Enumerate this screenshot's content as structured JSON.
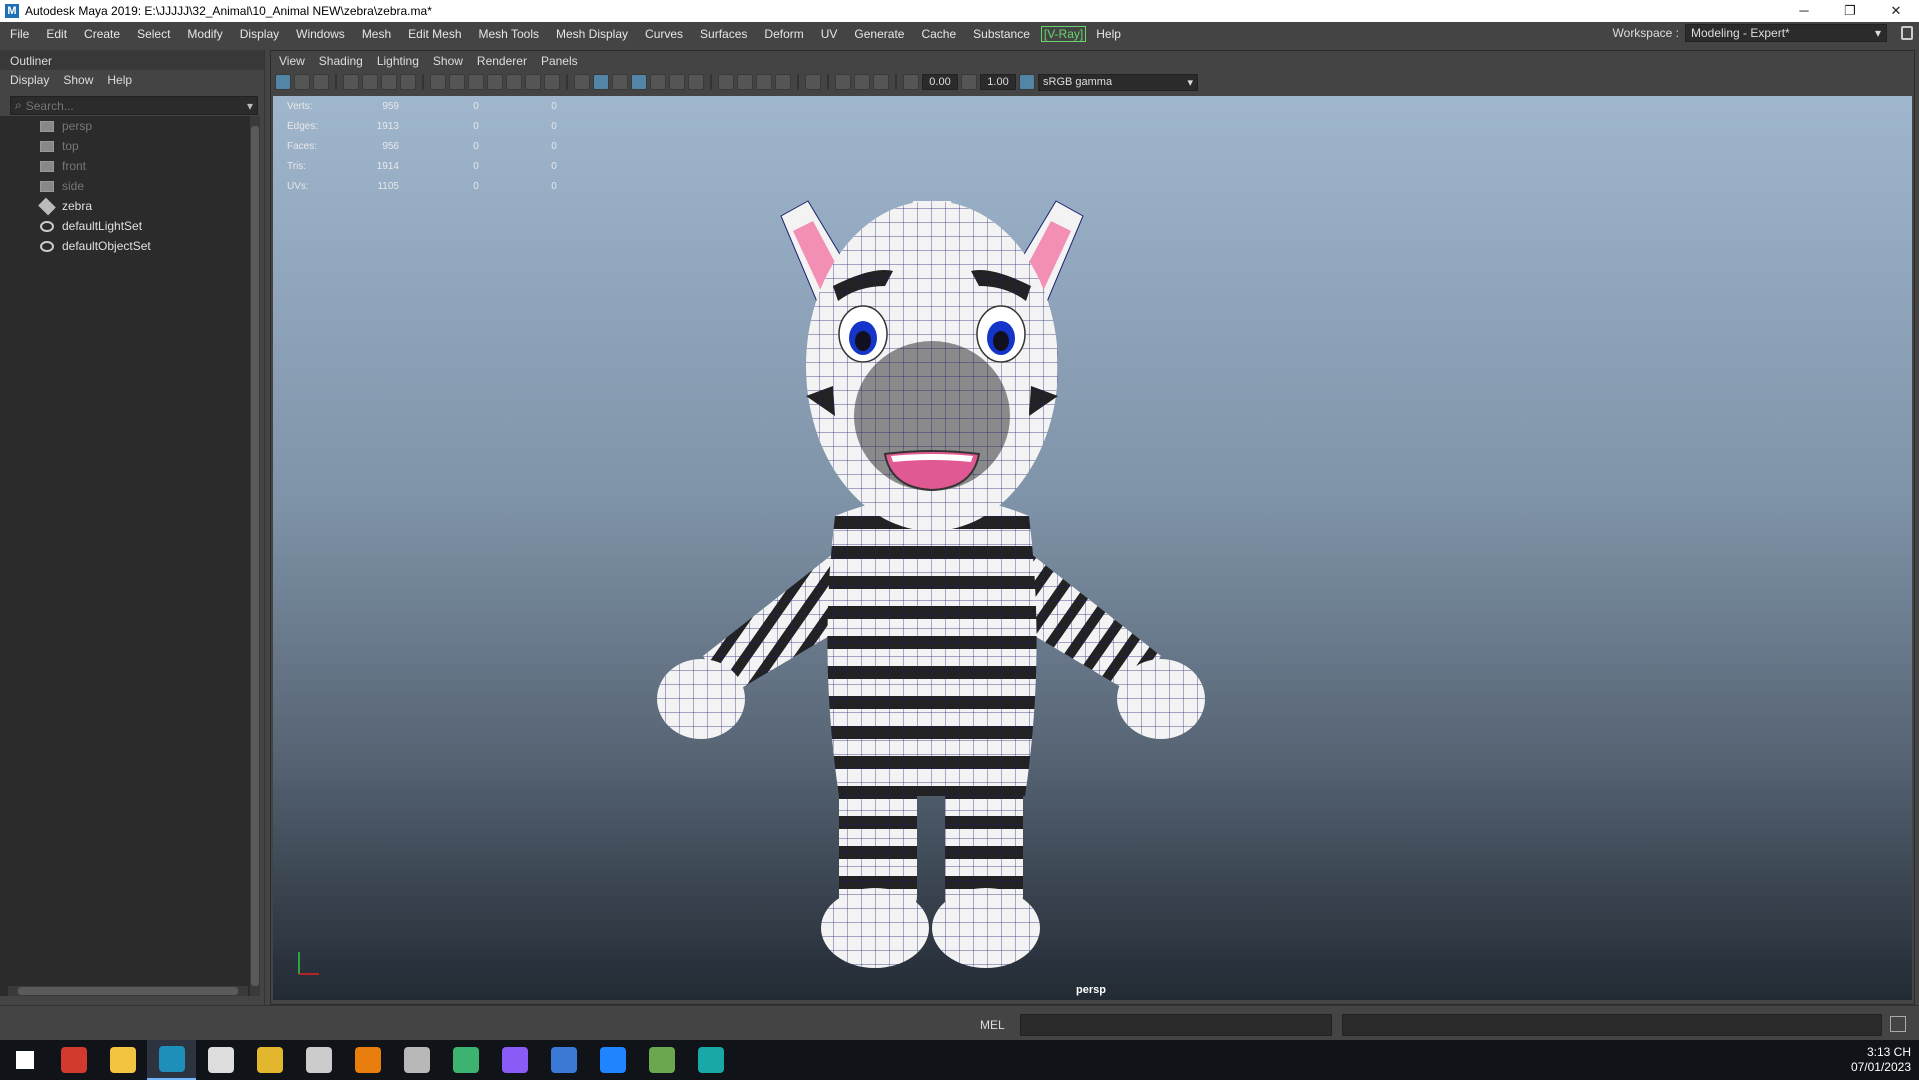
{
  "window": {
    "title": "Autodesk Maya 2019: E:\\JJJJJ\\32_Animal\\10_Animal NEW\\zebra\\zebra.ma*",
    "app_icon": "M",
    "controls": {
      "minimize": "─",
      "restore": "❐",
      "close": "✕"
    }
  },
  "menubar": {
    "items": [
      "File",
      "Edit",
      "Create",
      "Select",
      "Modify",
      "Display",
      "Windows",
      "Mesh",
      "Edit Mesh",
      "Mesh Tools",
      "Mesh Display",
      "Curves",
      "Surfaces",
      "Deform",
      "UV",
      "Generate",
      "Cache",
      "Substance"
    ],
    "vray": "[V-Ray]",
    "help": "Help",
    "workspace_label": "Workspace :",
    "workspace_value": "Modeling - Expert*"
  },
  "outliner": {
    "title": "Outliner",
    "menu": [
      "Display",
      "Show",
      "Help"
    ],
    "search_placeholder": "Search...",
    "items": [
      {
        "label": "persp",
        "icon": "camera-icon",
        "dim": true
      },
      {
        "label": "top",
        "icon": "camera-icon",
        "dim": true
      },
      {
        "label": "front",
        "icon": "camera-icon",
        "dim": true
      },
      {
        "label": "side",
        "icon": "camera-icon",
        "dim": true
      },
      {
        "label": "zebra",
        "icon": "mesh-icon",
        "dim": false
      },
      {
        "label": "defaultLightSet",
        "icon": "set-icon",
        "dim": false
      },
      {
        "label": "defaultObjectSet",
        "icon": "set-icon",
        "dim": false
      }
    ]
  },
  "viewport": {
    "menu": [
      "View",
      "Shading",
      "Lighting",
      "Show",
      "Renderer",
      "Panels"
    ],
    "exposure": "0.00",
    "gamma": "1.00",
    "color_space": "sRGB gamma",
    "camera_label": "persp",
    "hud": [
      {
        "label": "Verts:",
        "value": "959",
        "a": "0",
        "b": "0"
      },
      {
        "label": "Edges:",
        "value": "1913",
        "a": "0",
        "b": "0"
      },
      {
        "label": "Faces:",
        "value": "956",
        "a": "0",
        "b": "0"
      },
      {
        "label": "Tris:",
        "value": "1914",
        "a": "0",
        "b": "0"
      },
      {
        "label": "UVs:",
        "value": "1105",
        "a": "0",
        "b": "0"
      }
    ]
  },
  "cmdline": {
    "mel_label": "MEL"
  },
  "taskbar": {
    "time": "3:13 CH",
    "date": "07/01/2023",
    "apps": [
      {
        "name": "start-icon",
        "color": "#ffffff"
      },
      {
        "name": "app-red-icon",
        "color": "#d33a2f"
      },
      {
        "name": "file-explorer-icon",
        "color": "#f2c440"
      },
      {
        "name": "maya-icon",
        "color": "#1e8fb8"
      },
      {
        "name": "zbrush-icon",
        "color": "#dddddd"
      },
      {
        "name": "chrome-icon",
        "color": "#e2b72e"
      },
      {
        "name": "unity-icon",
        "color": "#cccccc"
      },
      {
        "name": "blender-icon",
        "color": "#e87d0d"
      },
      {
        "name": "app-gray-icon",
        "color": "#b8b8b8"
      },
      {
        "name": "upwork-icon",
        "color": "#3cb371"
      },
      {
        "name": "github-icon",
        "color": "#8a5cf5"
      },
      {
        "name": "word-icon",
        "color": "#3b79d6"
      },
      {
        "name": "zalo-icon",
        "color": "#1f84ff"
      },
      {
        "name": "app-green-icon",
        "color": "#6aa84f"
      },
      {
        "name": "3dsmax-icon",
        "color": "#18a8a8"
      }
    ]
  }
}
